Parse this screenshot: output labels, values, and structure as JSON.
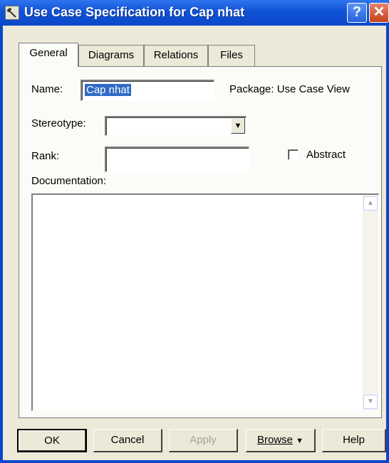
{
  "window": {
    "title": "Use Case Specification for Cap nhat",
    "help_label": "?",
    "close_label": "✕"
  },
  "tabs": [
    {
      "label": "General",
      "active": true
    },
    {
      "label": "Diagrams",
      "active": false
    },
    {
      "label": "Relations",
      "active": false
    },
    {
      "label": "Files",
      "active": false
    }
  ],
  "general": {
    "name_label": "Name:",
    "name_value": "Cap nhat",
    "package_label": "Package: Use Case View",
    "stereotype_label": "Stereotype:",
    "stereotype_value": "",
    "rank_label": "Rank:",
    "rank_value": "",
    "abstract_label": "Abstract",
    "abstract_checked": false,
    "documentation_label": "Documentation:",
    "documentation_value": ""
  },
  "buttons": {
    "ok": "OK",
    "cancel": "Cancel",
    "apply": "Apply",
    "browse": "Browse",
    "help": "Help"
  },
  "icons": {
    "app": "use-case-spec-icon",
    "dropdown": "chevron-down-icon",
    "scroll_up": "arrow-up-icon",
    "scroll_down": "arrow-down-icon"
  },
  "colors": {
    "titlebar": "#0a47c8",
    "selection": "#316ac5",
    "dialog_face": "#ece9d8"
  }
}
